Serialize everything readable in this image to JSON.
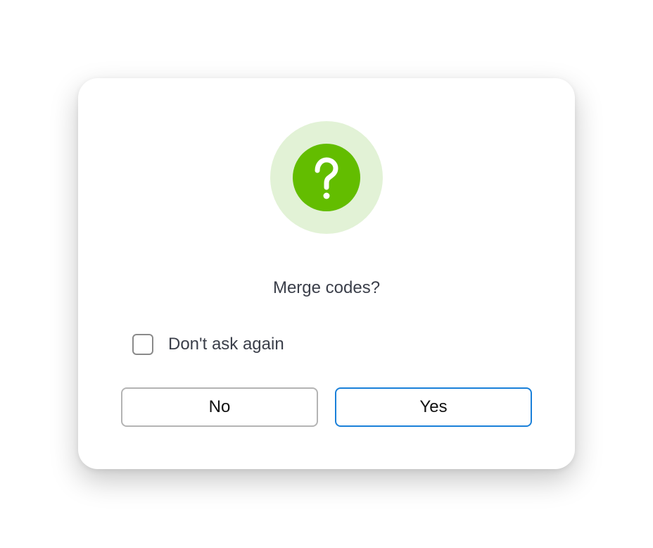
{
  "dialog": {
    "icon": "question-mark-icon",
    "message": "Merge codes?",
    "checkbox": {
      "label": "Don't ask again",
      "checked": false
    },
    "buttons": {
      "no_label": "No",
      "yes_label": "Yes"
    }
  },
  "colors": {
    "icon_fill": "#63bd00",
    "icon_halo": "#e2f2d6",
    "primary_border": "#1a80d9",
    "secondary_border": "#b4b4b4",
    "text": "#3b3f4a"
  }
}
